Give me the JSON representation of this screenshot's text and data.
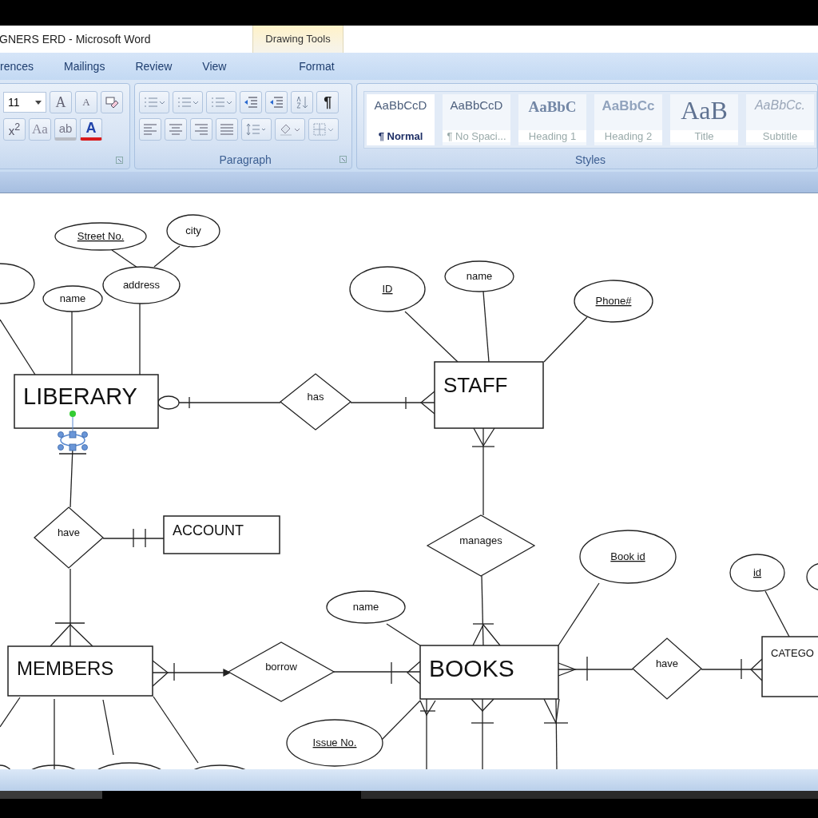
{
  "window": {
    "title": "GNERS ERD - Microsoft Word",
    "context_header": "Drawing Tools"
  },
  "tabs": [
    {
      "label": "rences",
      "selected": false,
      "kind": "normal"
    },
    {
      "label": "Mailings",
      "selected": false,
      "kind": "normal"
    },
    {
      "label": "Review",
      "selected": false,
      "kind": "normal"
    },
    {
      "label": "View",
      "selected": false,
      "kind": "normal"
    },
    {
      "label": "Format",
      "selected": false,
      "kind": "contextual"
    }
  ],
  "font_group": {
    "size": "11",
    "row1": [
      {
        "kind": "grow",
        "label": "A"
      },
      {
        "kind": "shrink",
        "label": "A"
      },
      {
        "kind": "clear"
      }
    ],
    "row2": [
      {
        "kind": "superscript",
        "label": "x$^{2}$"
      },
      {
        "kind": "case",
        "label": "Aa"
      },
      {
        "kind": "highlight",
        "label": "ab"
      },
      {
        "kind": "color",
        "label": "A"
      }
    ]
  },
  "paragraph_group": {
    "label": "Paragraph",
    "row1": [
      {
        "kind": "bullets"
      },
      {
        "kind": "numbering"
      },
      {
        "kind": "multilevel"
      },
      {
        "kind": "outdent"
      },
      {
        "kind": "indent"
      },
      {
        "kind": "sort"
      },
      {
        "kind": "pilcrow",
        "label": "¶"
      }
    ],
    "row2": [
      {
        "kind": "align-left"
      },
      {
        "kind": "align-center"
      },
      {
        "kind": "align-right"
      },
      {
        "kind": "justify"
      },
      {
        "kind": "spacing"
      },
      {
        "kind": "shading"
      },
      {
        "kind": "borders"
      }
    ]
  },
  "styles_group": {
    "label": "Styles",
    "items": [
      {
        "preview": "AaBbCcD",
        "label": "¶ Normal",
        "selected": true,
        "kind": "normal"
      },
      {
        "preview": "AaBbCcD",
        "label": "¶ No Spaci...",
        "selected": false,
        "kind": "normal"
      },
      {
        "preview": "AaBbC",
        "label": "Heading 1",
        "selected": false,
        "kind": "heading1"
      },
      {
        "preview": "AaBbCc",
        "label": "Heading 2",
        "selected": false,
        "kind": "heading2"
      },
      {
        "preview": "AaB",
        "label": "Title",
        "selected": false,
        "kind": "title"
      },
      {
        "preview": "AaBbCc.",
        "label": "Subtitle",
        "selected": false,
        "kind": "subtitle"
      }
    ]
  },
  "diagram": {
    "entities": [
      {
        "name": "LIBERARY"
      },
      {
        "name": "STAFF"
      },
      {
        "name": "ACCOUNT"
      },
      {
        "name": "MEMBERS"
      },
      {
        "name": "BOOKS"
      },
      {
        "name": "CATEGO"
      }
    ],
    "relationships": [
      {
        "name": "has"
      },
      {
        "name": "have"
      },
      {
        "name": "manages"
      },
      {
        "name": "borrow"
      },
      {
        "name": "have"
      }
    ],
    "attributes": [
      {
        "name": "Street No.",
        "key": true
      },
      {
        "name": "city",
        "key": false
      },
      {
        "name": "address",
        "key": false
      },
      {
        "name": "name",
        "key": false
      },
      {
        "name": "ID",
        "key": true
      },
      {
        "name": "name",
        "key": false
      },
      {
        "name": "Phone#",
        "key": true
      },
      {
        "name": "Book id",
        "key": true
      },
      {
        "name": "id",
        "key": true
      },
      {
        "name": "name",
        "key": false
      },
      {
        "name": "Issue No.",
        "key": true
      }
    ]
  }
}
